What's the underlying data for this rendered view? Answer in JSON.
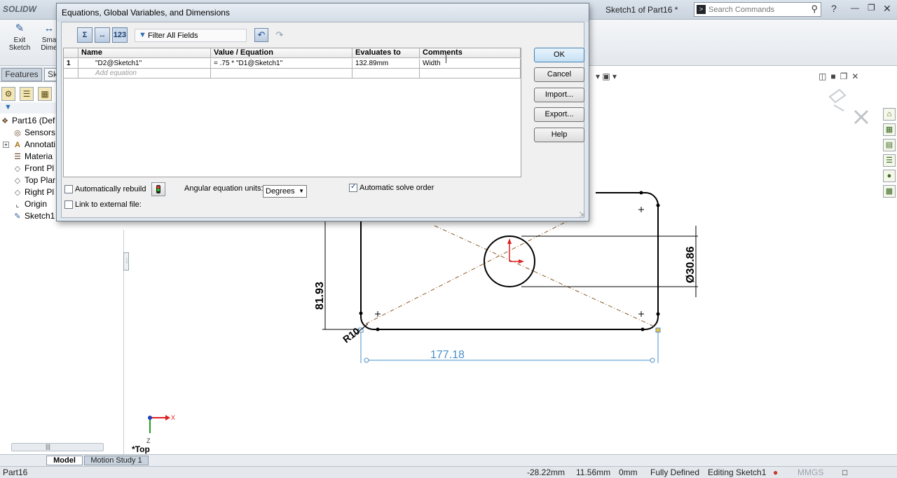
{
  "app": {
    "logo_text": "SOLIDW",
    "document_title": "Sketch1 of Part16 *",
    "search": {
      "placeholder": "Search Commands",
      "value": ""
    }
  },
  "commands": {
    "exit_sketch": "Exit\nSketch",
    "smart_dimension": "Sma\nDime"
  },
  "manager_tabs": {
    "features": "Features",
    "sketch": "Sk"
  },
  "feature_tree": [
    {
      "label": "Part16  (Def",
      "icon": "part-icon"
    },
    {
      "label": "Sensors",
      "icon": "sensors-icon"
    },
    {
      "label": "Annotati",
      "icon": "annotations-icon"
    },
    {
      "label": "Materia",
      "icon": "material-icon"
    },
    {
      "label": "Front Pl",
      "icon": "plane-icon"
    },
    {
      "label": "Top Plar",
      "icon": "plane-icon"
    },
    {
      "label": "Right Pl",
      "icon": "plane-icon"
    },
    {
      "label": "Origin",
      "icon": "origin-icon"
    },
    {
      "label": "Sketch1",
      "icon": "sketch-icon"
    }
  ],
  "dialog": {
    "title": "Equations, Global Variables, and Dimensions",
    "filter": {
      "value": "Filter All Fields"
    },
    "columns": [
      "Name",
      "Value / Equation",
      "Evaluates to",
      "Comments"
    ],
    "rows": [
      {
        "num": "1",
        "name": "\"D2@Sketch1\"",
        "value": "= .75 * \"D1@Sketch1\"",
        "evaluates": "132.89mm",
        "comment": "Width"
      }
    ],
    "add_equation": "Add equation",
    "buttons": {
      "ok": "OK",
      "cancel": "Cancel",
      "import": "Import...",
      "export": "Export...",
      "help": "Help"
    },
    "auto_rebuild": {
      "label": "Automatically rebuild",
      "checked": false
    },
    "link_external": {
      "label": "Link to external file:",
      "checked": false
    },
    "angular_units": {
      "label": "Angular equation units:",
      "value": "Degrees"
    },
    "auto_solve": {
      "label": "Automatic solve order",
      "checked": true
    }
  },
  "sketch": {
    "dimensions": {
      "height": "81.93",
      "width": "177.18",
      "diameter": "Ø30.86",
      "radius": "R10"
    },
    "view_label": "*Top",
    "triad": {
      "x": "X",
      "y": "Y",
      "z": "Z"
    }
  },
  "bottom_tabs": {
    "model": "Model",
    "motion": "Motion Study 1"
  },
  "status": {
    "part": "Part16",
    "x": "-28.22mm",
    "y": "11.56mm",
    "z": "0mm",
    "state": "Fully Defined",
    "mode": "Editing Sketch1",
    "units": "MMGS"
  },
  "colors": {
    "dimension_blue": "#4a90c8",
    "sketch_line": "#000000",
    "construction": "#8b5a2b",
    "origin_red": "#e02020"
  }
}
